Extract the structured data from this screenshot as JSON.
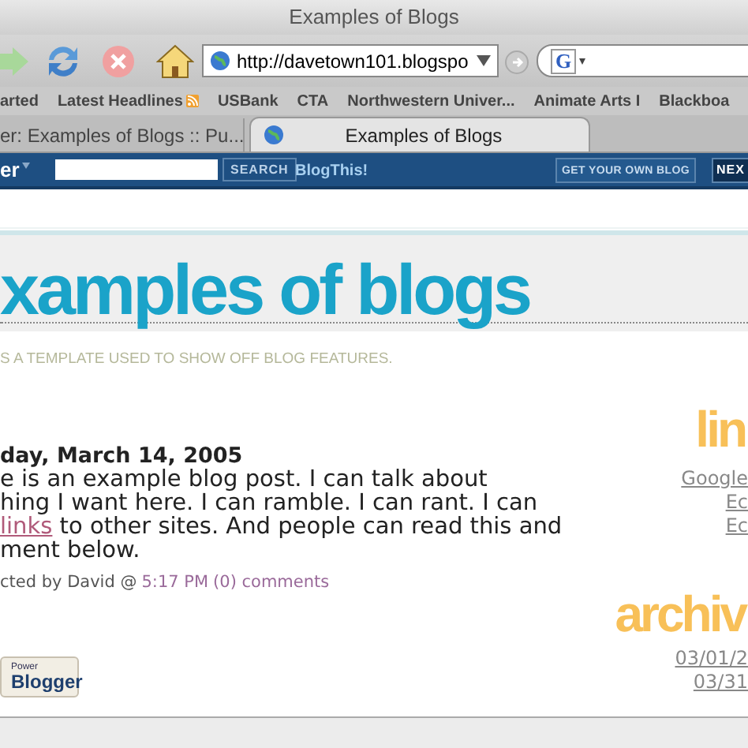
{
  "window": {
    "title": "Examples of Blogs"
  },
  "toolbar": {
    "url": "http://davetown101.blogspo",
    "search_engine_glyph": "G"
  },
  "bookmarks": [
    {
      "label": "arted",
      "feed": false
    },
    {
      "label": "Latest Headlines",
      "feed": true
    },
    {
      "label": "USBank",
      "feed": false
    },
    {
      "label": "CTA",
      "feed": false
    },
    {
      "label": "Northwestern Univer...",
      "feed": false
    },
    {
      "label": "Animate Arts I",
      "feed": false
    },
    {
      "label": "Blackboa",
      "feed": false
    }
  ],
  "tabs": [
    {
      "label": "er: Examples of Blogs :: Pu...",
      "selected": false
    },
    {
      "label": "Examples of Blogs",
      "selected": true
    }
  ],
  "navbar": {
    "logo": "er",
    "search_button": "SEARCH",
    "blogthis": "BlogThis!",
    "get_blog": "GET YOUR OWN BLOG",
    "next": "NEX"
  },
  "blog": {
    "title": "xamples of blogs",
    "description": "S A TEMPLATE USED TO SHOW OFF BLOG FEATURES."
  },
  "post": {
    "date": "day, March 14, 2005",
    "lines": [
      {
        "text": "e is an example blog post. I can talk about"
      },
      {
        "text": "hing I want here. I can ramble. I can rant. I can"
      },
      {
        "link": "links",
        "text": " to other sites. And people can read this and"
      },
      {
        "text": "ment below."
      }
    ],
    "byline": "cted by David @",
    "time": "5:17 PM",
    "comments": "(0) comments"
  },
  "sidebar": {
    "links_title": "lin",
    "links": [
      "Google",
      "Ec",
      "Ec"
    ],
    "archives_title": "archiv",
    "archives": [
      "03/01/2",
      "03/31"
    ]
  },
  "badge": {
    "small": "Power",
    "big": "Blogger"
  }
}
